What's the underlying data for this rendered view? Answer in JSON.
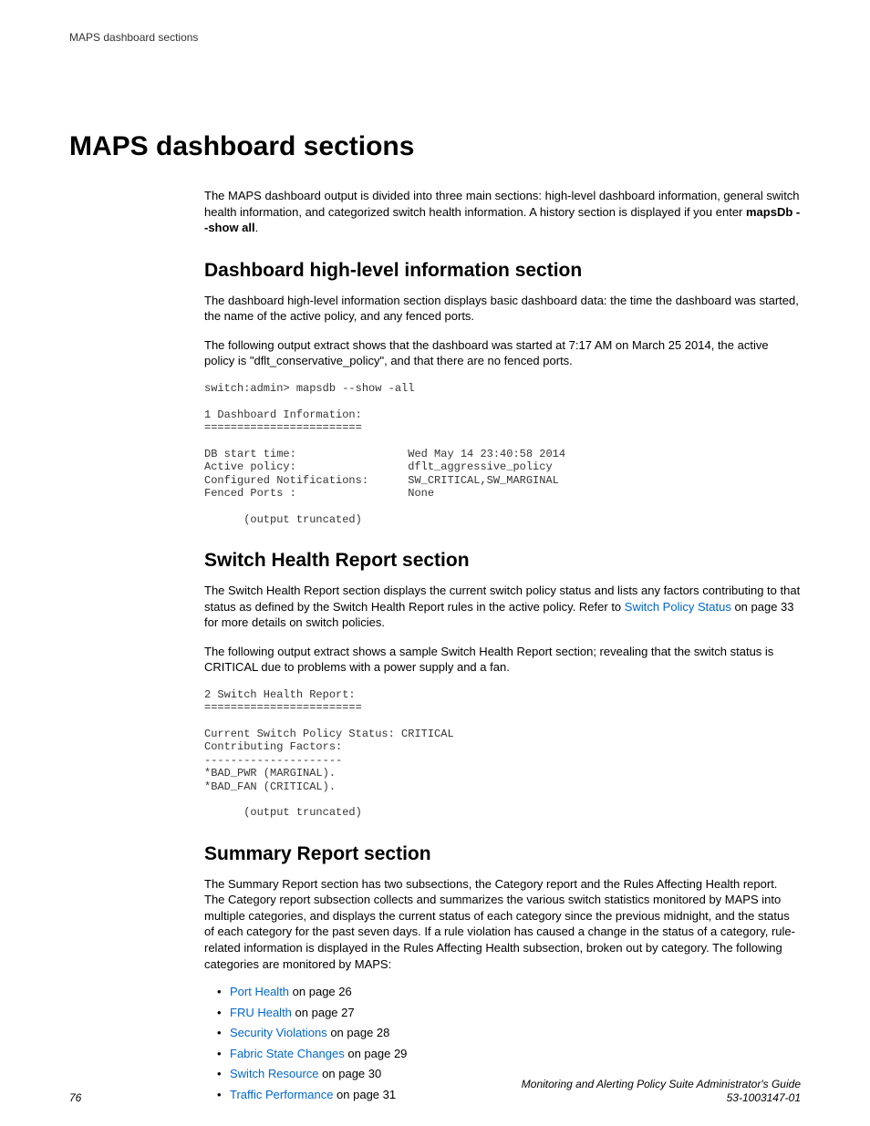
{
  "header_label": "MAPS dashboard sections",
  "title": "MAPS dashboard sections",
  "intro": {
    "p1a": "The MAPS dashboard output is divided into three main sections: high-level dashboard information, general switch health information, and categorized switch health information. A history section is displayed if you enter ",
    "p1b": "mapsDb --show all",
    "p1c": "."
  },
  "sec1": {
    "heading": "Dashboard high-level information section",
    "p1": "The dashboard high-level information section displays basic dashboard data: the time the dashboard was started, the name of the active policy, and any fenced ports.",
    "p2": "The following output extract shows that the dashboard was started at 7:17 AM on March 25 2014, the active policy is \"dflt_conservative_policy\", and that there are no fenced ports.",
    "code": "switch:admin> mapsdb --show -all\n\n1 Dashboard Information:\n========================\n\nDB start time:                 Wed May 14 23:40:58 2014\nActive policy:                 dflt_aggressive_policy\nConfigured Notifications:      SW_CRITICAL,SW_MARGINAL\nFenced Ports :                 None\n\n      (output truncated)"
  },
  "sec2": {
    "heading": "Switch Health Report section",
    "p1a": "The Switch Health Report section displays the current switch policy status and lists any factors contributing to that status as defined by the Switch Health Report rules in the active policy. Refer to ",
    "p1link": "Switch Policy Status",
    "p1b": " on page 33 for more details on switch policies.",
    "p2": "The following output extract shows a sample Switch Health Report section; revealing that the switch status is CRITICAL due to problems with a power supply and a fan.",
    "code": "2 Switch Health Report:\n========================\n\nCurrent Switch Policy Status: CRITICAL\nContributing Factors:\n---------------------\n*BAD_PWR (MARGINAL).\n*BAD_FAN (CRITICAL).\n\n      (output truncated)"
  },
  "sec3": {
    "heading": "Summary Report section",
    "p1": "The Summary Report section has two subsections, the Category report and the Rules Affecting Health report. The Category report subsection collects and summarizes the various switch statistics monitored by MAPS into multiple categories, and displays the current status of each category since the previous midnight, and the status of each category for the past seven days. If a rule violation has caused a change in the status of a category, rule-related information is displayed in the Rules Affecting Health subsection, broken out by category. The following categories are monitored by MAPS:",
    "items": [
      {
        "link": "Port Health",
        "rest": " on page 26"
      },
      {
        "link": "FRU Health",
        "rest": " on page 27"
      },
      {
        "link": "Security Violations",
        "rest": " on page 28"
      },
      {
        "link": "Fabric State Changes",
        "rest": " on page 29"
      },
      {
        "link": "Switch Resource",
        "rest": " on page 30"
      },
      {
        "link": "Traffic Performance",
        "rest": " on page 31"
      }
    ]
  },
  "footer": {
    "page": "76",
    "guide": "Monitoring and Alerting Policy Suite Administrator's Guide",
    "docnum": "53-1003147-01"
  }
}
